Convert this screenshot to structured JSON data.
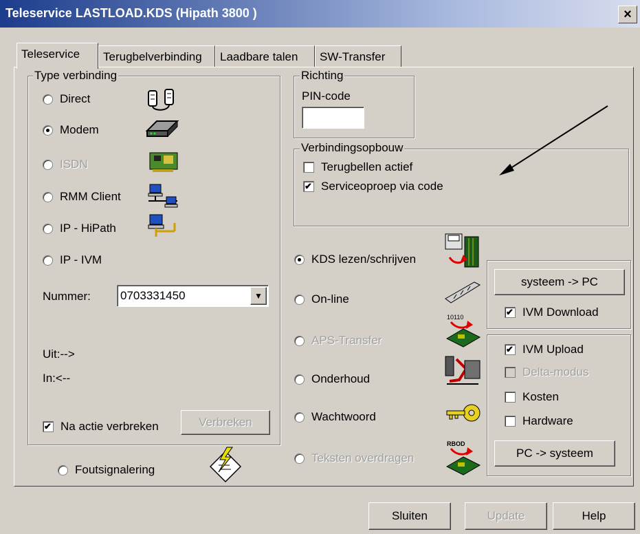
{
  "window": {
    "title": "Teleservice  LASTLOAD.KDS (Hipath 3800 )",
    "close": "×"
  },
  "tabs": [
    "Teleservice",
    "Terugbelverbinding",
    "Laadbare talen",
    "SW-Transfer"
  ],
  "type_verbinding": {
    "label": "Type verbinding",
    "options": [
      "Direct",
      "Modem",
      "ISDN",
      "RMM Client",
      "IP - HiPath",
      "IP - IVM"
    ],
    "selected": "Modem",
    "nummer_label": "Nummer:",
    "nummer_value": "0703331450",
    "uit_label": "Uit:-->",
    "in_label": "In:<--",
    "na_actie_label": "Na actie verbreken",
    "na_actie_checked": true,
    "verbreken_label": "Verbreken"
  },
  "foutsignalering_label": "Foutsignalering",
  "richting": {
    "label": "Richting",
    "pin_label": "PIN-code",
    "pin_value": ""
  },
  "verbindingsopbouw": {
    "label": "Verbindingsopbouw",
    "terugbellen_label": "Terugbellen actief",
    "terugbellen_checked": false,
    "serviceoproep_label": "Serviceoproep via code",
    "serviceoproep_checked": true
  },
  "actions": {
    "options": [
      "KDS lezen/schrijven",
      "On-line",
      "APS-Transfer",
      "Onderhoud",
      "Wachtwoord",
      "Teksten overdragen"
    ],
    "selected": "KDS lezen/schrijven"
  },
  "transfer": {
    "systeem_pc_label": "systeem -> PC",
    "ivm_download_label": "IVM Download",
    "ivm_download_checked": true,
    "ivm_upload_label": "IVM Upload",
    "ivm_upload_checked": true,
    "delta_label": "Delta-modus",
    "kosten_label": "Kosten",
    "hardware_label": "Hardware",
    "pc_systeem_label": "PC -> systeem"
  },
  "footer": {
    "sluiten": "Sluiten",
    "update": "Update",
    "help": "Help"
  },
  "icon_labels": {
    "aps": "10110",
    "teksten": "RBOD"
  },
  "icons": [
    "serial-cable-icon",
    "modem-icon",
    "isdn-card-icon",
    "network-computers-icon",
    "ip-network-icon",
    "lightning-document-icon",
    "kds-read-write-icon",
    "online-cable-icon",
    "aps-transfer-icon",
    "maintenance-tools-icon",
    "key-icon",
    "text-transfer-icon"
  ],
  "colors": {
    "face": "#d4d0c8",
    "title_start": "#1c3d8c",
    "disabled_text": "#a0a0a0"
  }
}
